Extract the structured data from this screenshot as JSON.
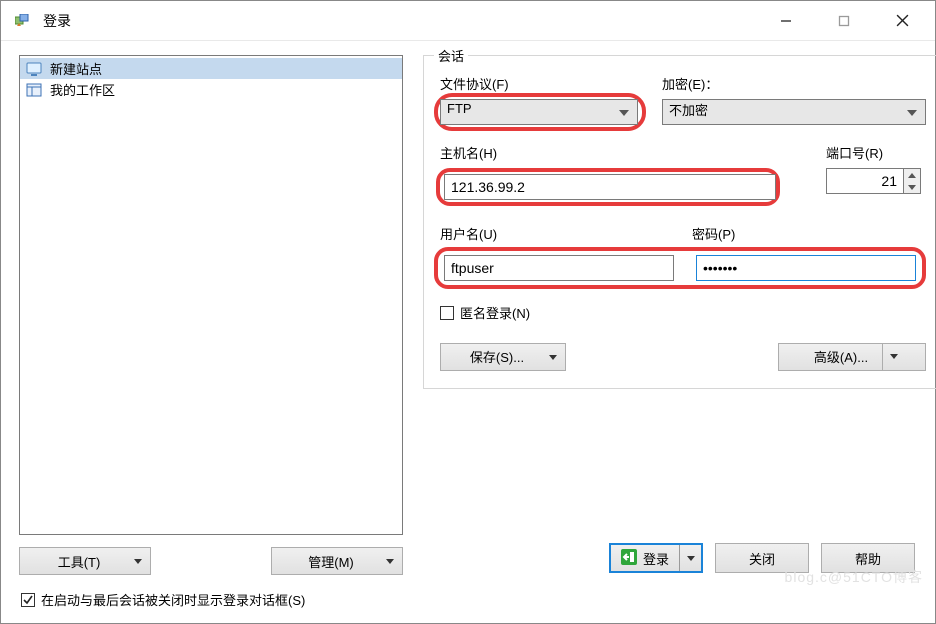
{
  "window": {
    "title": "登录"
  },
  "sites": {
    "items": [
      {
        "label": "新建站点",
        "selected": true,
        "icon": "monitor"
      },
      {
        "label": "我的工作区",
        "selected": false,
        "icon": "panel"
      }
    ]
  },
  "left_buttons": {
    "tools": "工具(T)",
    "manage": "管理(M)"
  },
  "session": {
    "group_title": "会话",
    "protocol_label": "文件协议(F)",
    "protocol_value": "FTP",
    "encryption_label": "加密(E)：",
    "encryption_value": "不加密",
    "host_label": "主机名(H)",
    "host_value": "121.36.99.2",
    "port_label": "端口号(R)",
    "port_value": "21",
    "user_label": "用户名(U)",
    "user_value": "ftpuser",
    "password_label": "密码(P)",
    "password_value": "•••••••",
    "anonymous_label": "匿名登录(N)",
    "save_label": "保存(S)...",
    "advanced_label": "高级(A)..."
  },
  "buttons": {
    "login": "登录",
    "close": "关闭",
    "help": "帮助"
  },
  "footer": {
    "show_login_dialog": "在启动与最后会话被关闭时显示登录对话框(S)",
    "checked": true
  },
  "watermark": "blog.c@51CTO博客"
}
